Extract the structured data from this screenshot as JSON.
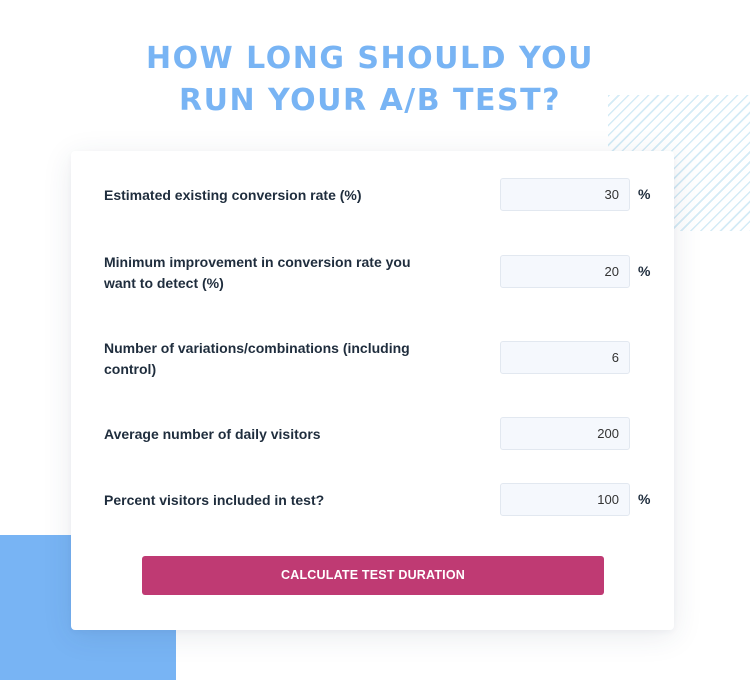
{
  "header": {
    "title_line1": "HOW LONG SHOULD YOU",
    "title_line2": "RUN YOUR A/B TEST?"
  },
  "colors": {
    "title": "#78b4f4",
    "accent_block": "#78b4f4",
    "button": "#bf3a73",
    "input_bg": "#f5f8fd"
  },
  "form": {
    "fields": [
      {
        "label": "Estimated existing conversion rate (%)",
        "value": "30",
        "unit": "%"
      },
      {
        "label": "Minimum improvement in conversion rate you want to detect (%)",
        "value": "20",
        "unit": "%"
      },
      {
        "label": "Number of variations/combinations (including control)",
        "value": "6",
        "unit": ""
      },
      {
        "label": "Average number of daily visitors",
        "value": "200",
        "unit": ""
      },
      {
        "label": "Percent visitors included in test?",
        "value": "100",
        "unit": "%"
      }
    ],
    "submit_label": "CALCULATE TEST DURATION"
  }
}
